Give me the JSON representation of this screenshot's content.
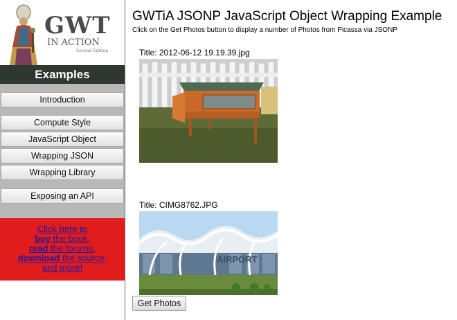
{
  "sidebar": {
    "logo": {
      "title": "GWT",
      "subtitle": "IN ACTION",
      "edition": "Second Edition"
    },
    "examples_heading": "Examples",
    "nav_items": [
      {
        "label": "Introduction"
      },
      {
        "label": "Compute Style"
      },
      {
        "label": "JavaScript Object"
      },
      {
        "label": "Wrapping JSON"
      },
      {
        "label": "Wrapping Library"
      },
      {
        "label": "Exposing an API"
      }
    ],
    "promo": {
      "line1": "Click here to",
      "buy": "buy",
      "line2": " the book,",
      "read": "read",
      "line3": " the forums,",
      "download": "download",
      "line4": " the source,",
      "line5": "and more!"
    }
  },
  "main": {
    "title": "GWTiA JSONP JavaScript Object Wrapping Example",
    "subtitle": "Click on the Get Photos button to display a number of Photos from Picassa via JSONP",
    "photos": [
      {
        "title": "Title: 2012-06-12 19.19.39.jpg",
        "description": "wooden rabbit hutch on grass"
      },
      {
        "title": "Title: CIMG8762.JPG",
        "description": "airport terminal with wave roof"
      }
    ],
    "get_photos_label": "Get Photos"
  },
  "colors": {
    "sidebar_header_bg": "#2f3731",
    "nav_bg": "#b8b8b8",
    "promo_bg": "#e01c1c",
    "link": "#1a1aa6"
  }
}
